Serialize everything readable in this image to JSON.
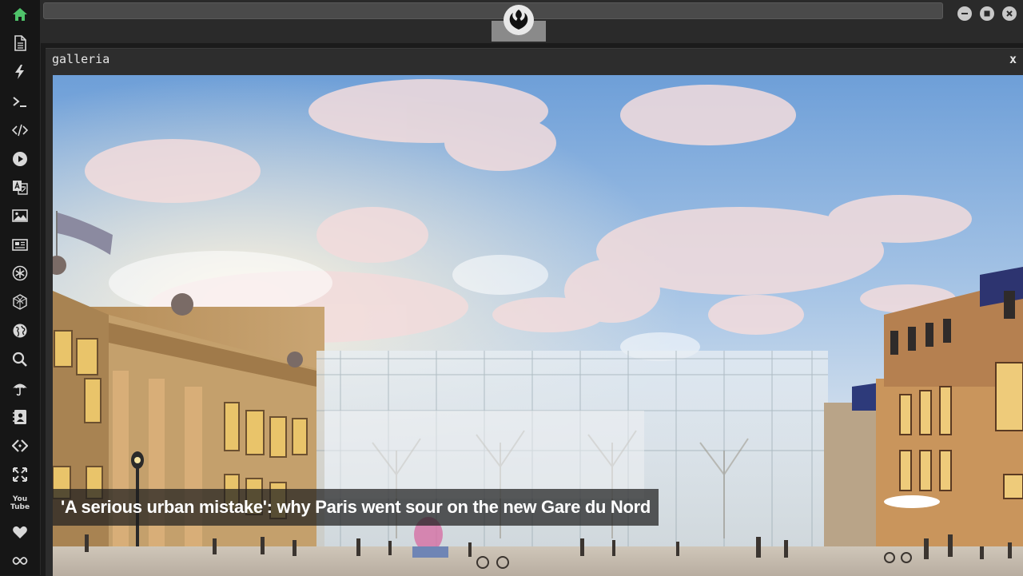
{
  "window": {
    "buttons": [
      {
        "icon": "minimize-icon"
      },
      {
        "icon": "maximize-icon"
      },
      {
        "icon": "close-icon"
      }
    ],
    "logo_icon": "rebel-alliance-icon"
  },
  "sidebar": {
    "items": [
      {
        "icon": "home-icon",
        "active": true
      },
      {
        "icon": "document-icon"
      },
      {
        "icon": "lightning-icon"
      },
      {
        "icon": "terminal-icon"
      },
      {
        "icon": "code-icon"
      },
      {
        "icon": "play-icon"
      },
      {
        "icon": "translate-icon"
      },
      {
        "icon": "image-icon"
      },
      {
        "icon": "newspaper-icon"
      },
      {
        "icon": "asterisk-icon"
      },
      {
        "icon": "cube-icon"
      },
      {
        "icon": "globe-icon"
      },
      {
        "icon": "search-icon"
      },
      {
        "icon": "umbrella-icon"
      },
      {
        "icon": "contact-card-icon"
      },
      {
        "icon": "embed-icon"
      },
      {
        "icon": "fullscreen-icon"
      },
      {
        "icon": "youtube-icon",
        "text": "You\nTube"
      },
      {
        "icon": "heart-icon"
      },
      {
        "icon": "infinity-icon"
      }
    ],
    "active_color": "#4fc36a"
  },
  "panel": {
    "title": "galleria",
    "close_label": "x"
  },
  "gallery": {
    "caption": "'A serious urban mistake': why Paris went sour on the new Gare du Nord"
  }
}
